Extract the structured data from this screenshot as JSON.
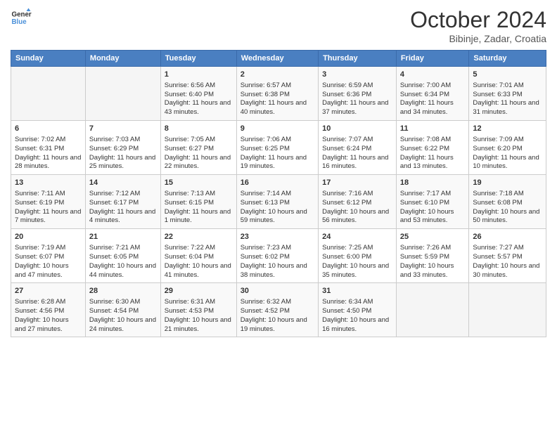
{
  "header": {
    "logo_line1": "General",
    "logo_line2": "Blue",
    "month": "October 2024",
    "location": "Bibinje, Zadar, Croatia"
  },
  "days_of_week": [
    "Sunday",
    "Monday",
    "Tuesday",
    "Wednesday",
    "Thursday",
    "Friday",
    "Saturday"
  ],
  "weeks": [
    [
      {
        "day": "",
        "sunrise": "",
        "sunset": "",
        "daylight": ""
      },
      {
        "day": "",
        "sunrise": "",
        "sunset": "",
        "daylight": ""
      },
      {
        "day": "1",
        "sunrise": "Sunrise: 6:56 AM",
        "sunset": "Sunset: 6:40 PM",
        "daylight": "Daylight: 11 hours and 43 minutes."
      },
      {
        "day": "2",
        "sunrise": "Sunrise: 6:57 AM",
        "sunset": "Sunset: 6:38 PM",
        "daylight": "Daylight: 11 hours and 40 minutes."
      },
      {
        "day": "3",
        "sunrise": "Sunrise: 6:59 AM",
        "sunset": "Sunset: 6:36 PM",
        "daylight": "Daylight: 11 hours and 37 minutes."
      },
      {
        "day": "4",
        "sunrise": "Sunrise: 7:00 AM",
        "sunset": "Sunset: 6:34 PM",
        "daylight": "Daylight: 11 hours and 34 minutes."
      },
      {
        "day": "5",
        "sunrise": "Sunrise: 7:01 AM",
        "sunset": "Sunset: 6:33 PM",
        "daylight": "Daylight: 11 hours and 31 minutes."
      }
    ],
    [
      {
        "day": "6",
        "sunrise": "Sunrise: 7:02 AM",
        "sunset": "Sunset: 6:31 PM",
        "daylight": "Daylight: 11 hours and 28 minutes."
      },
      {
        "day": "7",
        "sunrise": "Sunrise: 7:03 AM",
        "sunset": "Sunset: 6:29 PM",
        "daylight": "Daylight: 11 hours and 25 minutes."
      },
      {
        "day": "8",
        "sunrise": "Sunrise: 7:05 AM",
        "sunset": "Sunset: 6:27 PM",
        "daylight": "Daylight: 11 hours and 22 minutes."
      },
      {
        "day": "9",
        "sunrise": "Sunrise: 7:06 AM",
        "sunset": "Sunset: 6:25 PM",
        "daylight": "Daylight: 11 hours and 19 minutes."
      },
      {
        "day": "10",
        "sunrise": "Sunrise: 7:07 AM",
        "sunset": "Sunset: 6:24 PM",
        "daylight": "Daylight: 11 hours and 16 minutes."
      },
      {
        "day": "11",
        "sunrise": "Sunrise: 7:08 AM",
        "sunset": "Sunset: 6:22 PM",
        "daylight": "Daylight: 11 hours and 13 minutes."
      },
      {
        "day": "12",
        "sunrise": "Sunrise: 7:09 AM",
        "sunset": "Sunset: 6:20 PM",
        "daylight": "Daylight: 11 hours and 10 minutes."
      }
    ],
    [
      {
        "day": "13",
        "sunrise": "Sunrise: 7:11 AM",
        "sunset": "Sunset: 6:19 PM",
        "daylight": "Daylight: 11 hours and 7 minutes."
      },
      {
        "day": "14",
        "sunrise": "Sunrise: 7:12 AM",
        "sunset": "Sunset: 6:17 PM",
        "daylight": "Daylight: 11 hours and 4 minutes."
      },
      {
        "day": "15",
        "sunrise": "Sunrise: 7:13 AM",
        "sunset": "Sunset: 6:15 PM",
        "daylight": "Daylight: 11 hours and 1 minute."
      },
      {
        "day": "16",
        "sunrise": "Sunrise: 7:14 AM",
        "sunset": "Sunset: 6:13 PM",
        "daylight": "Daylight: 10 hours and 59 minutes."
      },
      {
        "day": "17",
        "sunrise": "Sunrise: 7:16 AM",
        "sunset": "Sunset: 6:12 PM",
        "daylight": "Daylight: 10 hours and 56 minutes."
      },
      {
        "day": "18",
        "sunrise": "Sunrise: 7:17 AM",
        "sunset": "Sunset: 6:10 PM",
        "daylight": "Daylight: 10 hours and 53 minutes."
      },
      {
        "day": "19",
        "sunrise": "Sunrise: 7:18 AM",
        "sunset": "Sunset: 6:08 PM",
        "daylight": "Daylight: 10 hours and 50 minutes."
      }
    ],
    [
      {
        "day": "20",
        "sunrise": "Sunrise: 7:19 AM",
        "sunset": "Sunset: 6:07 PM",
        "daylight": "Daylight: 10 hours and 47 minutes."
      },
      {
        "day": "21",
        "sunrise": "Sunrise: 7:21 AM",
        "sunset": "Sunset: 6:05 PM",
        "daylight": "Daylight: 10 hours and 44 minutes."
      },
      {
        "day": "22",
        "sunrise": "Sunrise: 7:22 AM",
        "sunset": "Sunset: 6:04 PM",
        "daylight": "Daylight: 10 hours and 41 minutes."
      },
      {
        "day": "23",
        "sunrise": "Sunrise: 7:23 AM",
        "sunset": "Sunset: 6:02 PM",
        "daylight": "Daylight: 10 hours and 38 minutes."
      },
      {
        "day": "24",
        "sunrise": "Sunrise: 7:25 AM",
        "sunset": "Sunset: 6:00 PM",
        "daylight": "Daylight: 10 hours and 35 minutes."
      },
      {
        "day": "25",
        "sunrise": "Sunrise: 7:26 AM",
        "sunset": "Sunset: 5:59 PM",
        "daylight": "Daylight: 10 hours and 33 minutes."
      },
      {
        "day": "26",
        "sunrise": "Sunrise: 7:27 AM",
        "sunset": "Sunset: 5:57 PM",
        "daylight": "Daylight: 10 hours and 30 minutes."
      }
    ],
    [
      {
        "day": "27",
        "sunrise": "Sunrise: 6:28 AM",
        "sunset": "Sunset: 4:56 PM",
        "daylight": "Daylight: 10 hours and 27 minutes."
      },
      {
        "day": "28",
        "sunrise": "Sunrise: 6:30 AM",
        "sunset": "Sunset: 4:54 PM",
        "daylight": "Daylight: 10 hours and 24 minutes."
      },
      {
        "day": "29",
        "sunrise": "Sunrise: 6:31 AM",
        "sunset": "Sunset: 4:53 PM",
        "daylight": "Daylight: 10 hours and 21 minutes."
      },
      {
        "day": "30",
        "sunrise": "Sunrise: 6:32 AM",
        "sunset": "Sunset: 4:52 PM",
        "daylight": "Daylight: 10 hours and 19 minutes."
      },
      {
        "day": "31",
        "sunrise": "Sunrise: 6:34 AM",
        "sunset": "Sunset: 4:50 PM",
        "daylight": "Daylight: 10 hours and 16 minutes."
      },
      {
        "day": "",
        "sunrise": "",
        "sunset": "",
        "daylight": ""
      },
      {
        "day": "",
        "sunrise": "",
        "sunset": "",
        "daylight": ""
      }
    ]
  ]
}
